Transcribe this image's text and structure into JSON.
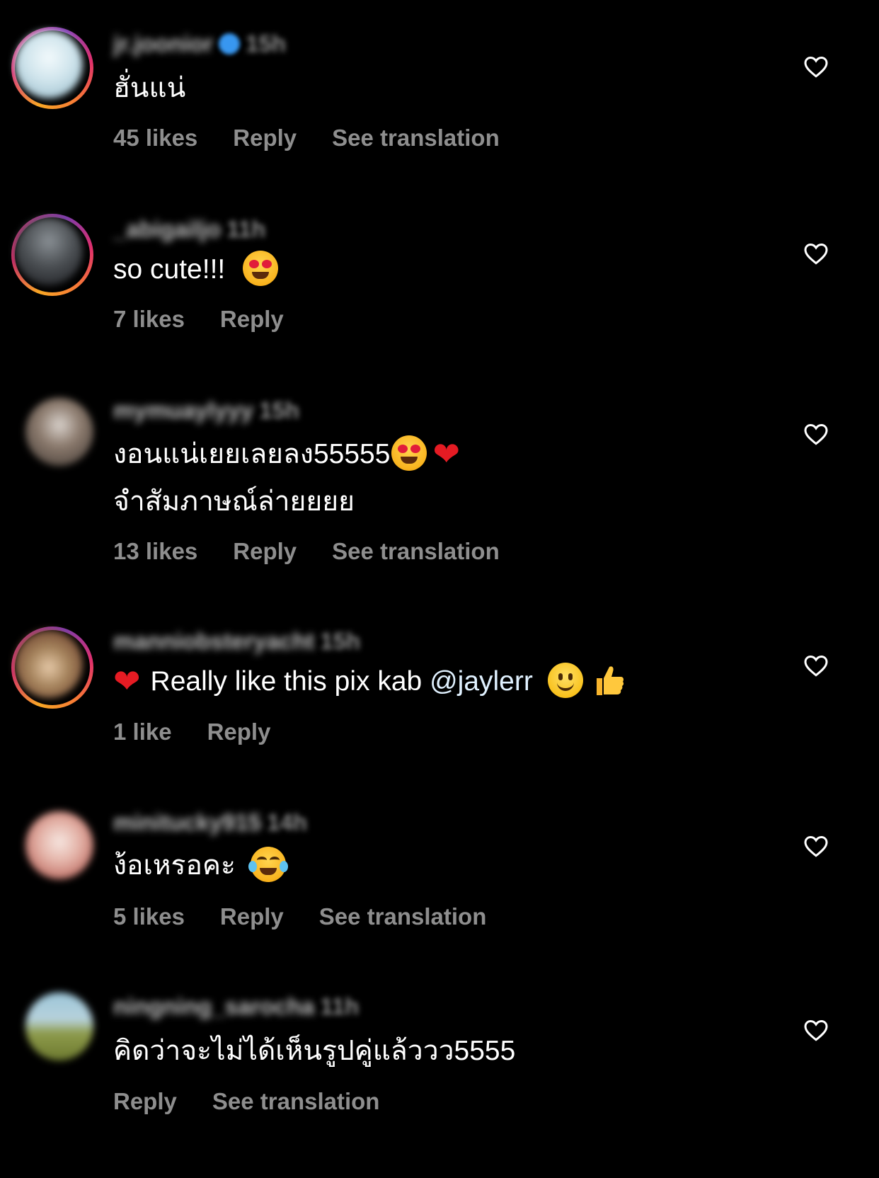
{
  "comments": [
    {
      "username": "jr.joonior",
      "verified": true,
      "time": "15h",
      "lines": [
        "ฮั่นแน่"
      ],
      "likes": "45 likes",
      "reply": "Reply",
      "translate": "See translation",
      "avatar_colors": [
        "#e9f4f7",
        "#a9c9d6"
      ]
    },
    {
      "username": "_abigailjo",
      "verified": false,
      "time": "11h",
      "lines": [
        "so cute!!!"
      ],
      "emoji": "heart-eyes",
      "likes": "7 likes",
      "reply": "Reply",
      "avatar_colors": [
        "#6b6f73",
        "#1e1f24"
      ]
    },
    {
      "username": "mymuaylyyy",
      "verified": false,
      "time": "15h",
      "lines": [
        "งอนแน่เยยเลยลง55555",
        "จำสัมภาษณ์ล่ายยยย"
      ],
      "likes": "13 likes",
      "reply": "Reply",
      "translate": "See translation",
      "avatar_colors": [
        "#8c7b6e",
        "#3d3530"
      ]
    },
    {
      "username": "manniobsteryacht",
      "verified": false,
      "time": "15h",
      "lines": [
        "Really like this pix kab"
      ],
      "mention": "@jaylerr",
      "likes": "1 like",
      "reply": "Reply",
      "avatar_colors": [
        "#a4825b",
        "#5a2a1f"
      ]
    },
    {
      "username": "minitucky915",
      "verified": false,
      "time": "14h",
      "lines": [
        "ง้อเหรอคะ"
      ],
      "emoji": "joy",
      "likes": "5 likes",
      "reply": "Reply",
      "translate": "See translation",
      "avatar_colors": [
        "#f2d9d2",
        "#c05a4f"
      ]
    },
    {
      "username": "ningning_sarocha",
      "verified": false,
      "time": "11h",
      "lines": [
        "คิดว่าจะไม่ได้เห็นรูปคู่แล้ววว5555"
      ],
      "reply": "Reply",
      "translate": "See translation",
      "avatar_colors": [
        "#9cc5d8",
        "#7a8a3c"
      ]
    }
  ]
}
